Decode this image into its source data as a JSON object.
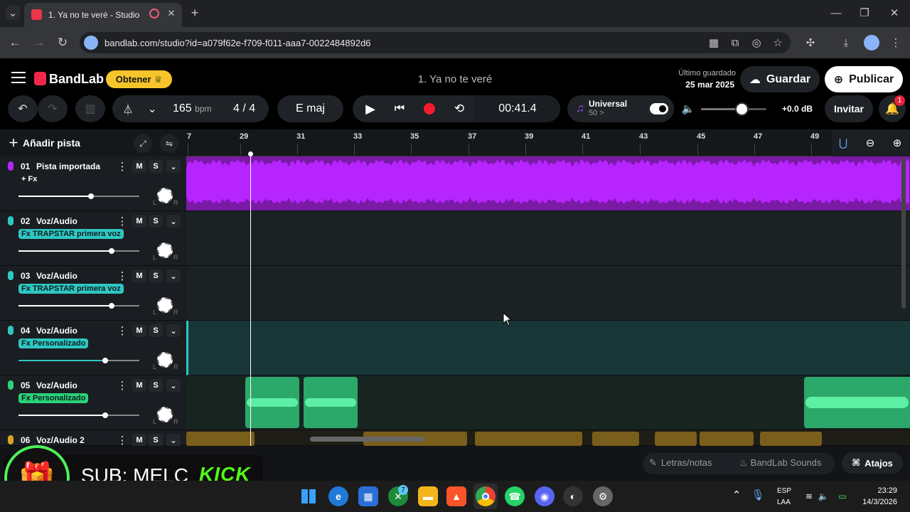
{
  "browser": {
    "tab_title": "1. Ya no te veré - Studio",
    "url": "bandlab.com/studio?id=a079f62e-f709-f011-aaa7-0022484892d6"
  },
  "header": {
    "logo": "BandLab",
    "obtener": "Obtener",
    "project_title": "1. Ya no te veré",
    "last_saved_label": "Último guardado",
    "last_saved_date": "25 mar 2025",
    "guardar": "Guardar",
    "publicar": "Publicar"
  },
  "toolbar": {
    "bpm_value": "165",
    "bpm_unit": "bpm",
    "time_sig": "4 / 4",
    "key": "E maj",
    "time": "00:41.4",
    "universal_label": "Universal",
    "universal_sub": "50 >",
    "db": "+0.0 dB",
    "invitar": "Invitar",
    "notif_count": "1",
    "volume_level": 0.62
  },
  "timeline": {
    "add_track": "Añadir pista",
    "ruler": [
      "7",
      "29",
      "31",
      "33",
      "35",
      "37",
      "39",
      "41",
      "43",
      "45",
      "47",
      "49"
    ]
  },
  "tracks": [
    {
      "num": "01",
      "name": "Pista importada",
      "fx": "+ Fx",
      "color": "#b026ff",
      "slider": 0.6
    },
    {
      "num": "02",
      "name": "Voz/Audio",
      "fx": "Fx TRAPSTAR primera voz",
      "color": "#2fc7c3",
      "slider": 0.77
    },
    {
      "num": "03",
      "name": "Voz/Audio",
      "fx": "Fx TRAPSTAR primera voz",
      "color": "#2fc7c3",
      "slider": 0.77
    },
    {
      "num": "04",
      "name": "Voz/Audio",
      "fx": "Fx Personalizado",
      "color": "#2fc7c3",
      "slider": 0.72
    },
    {
      "num": "05",
      "name": "Voz/Audio",
      "fx": "Fx Personalizado",
      "color": "#2ad37a",
      "slider": 0.72
    },
    {
      "num": "06",
      "name": "Voz/Audio 2",
      "fx": "",
      "color": "#d9a520",
      "slider": 0.0
    }
  ],
  "track_controls": {
    "m": "M",
    "s": "S",
    "l": "L",
    "r": "R"
  },
  "bottom": {
    "letras": "Letras/notas",
    "sounds": "BandLab Sounds",
    "atajos": "Atajos"
  },
  "overlay": {
    "sub_text": "SUB: MELC",
    "kick": "KICK"
  },
  "taskbar": {
    "lang1": "ESP",
    "lang2": "LAA",
    "time": "23:29",
    "date": "14/3/2026",
    "xbox_badge": "7"
  }
}
